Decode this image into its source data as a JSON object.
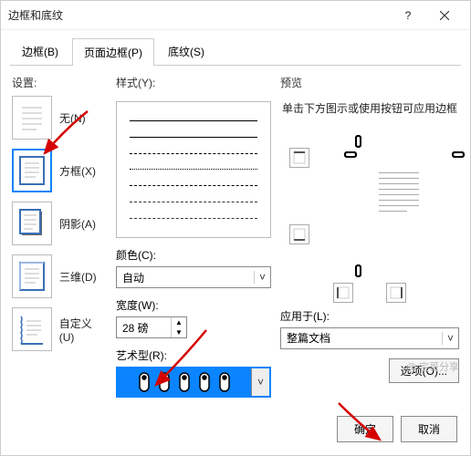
{
  "window": {
    "title": "边框和底纹"
  },
  "tabs": {
    "border": "边框(B)",
    "page_border": "页面边框(P)",
    "shading": "底纹(S)"
  },
  "left": {
    "section": "设置:",
    "none": "无(N)",
    "box": "方框(X)",
    "shadow": "阴影(A)",
    "threeD": "三维(D)",
    "custom": "自定义(U)"
  },
  "middle": {
    "style": "样式(Y):",
    "color": "颜色(C):",
    "color_value": "自动",
    "width": "宽度(W):",
    "width_value": "28 磅",
    "art": "艺术型(R):"
  },
  "right": {
    "preview": "预览",
    "hint": "单击下方图示或使用按钮可应用边框",
    "applied": "应用于(L):",
    "applied_value": "整篇文档",
    "options": "选项(O)..."
  },
  "footer": {
    "ok": "确定",
    "cancel": "取消"
  },
  "watermark": "@ 宅哥分享"
}
